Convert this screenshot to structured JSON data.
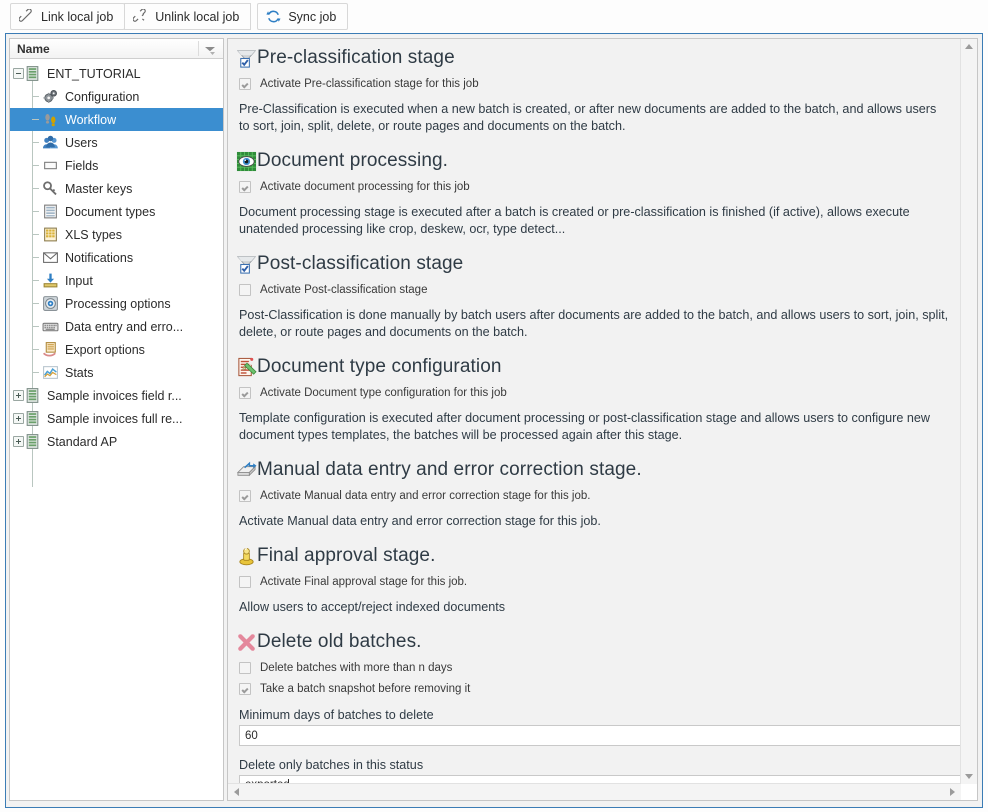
{
  "toolbar": {
    "buttons": [
      {
        "label": "Link local job",
        "icon": "link-icon"
      },
      {
        "label": "Unlink local job",
        "icon": "unlink-icon"
      },
      {
        "label": "Sync job",
        "icon": "sync-icon"
      }
    ]
  },
  "tree": {
    "header": "Name",
    "sort_icon": "sort-filter-icon",
    "nodes": [
      {
        "label": "ENT_TUTORIAL",
        "icon": "server-icon",
        "depth": 0,
        "expander": "minus",
        "selected": false
      },
      {
        "label": "Configuration",
        "icon": "gears-icon",
        "depth": 1,
        "expander": "none",
        "selected": false
      },
      {
        "label": "Workflow",
        "icon": "footprints-icon",
        "depth": 1,
        "expander": "none",
        "selected": true
      },
      {
        "label": "Users",
        "icon": "users-icon",
        "depth": 1,
        "expander": "none",
        "selected": false
      },
      {
        "label": "Fields",
        "icon": "field-box-icon",
        "depth": 1,
        "expander": "none",
        "selected": false
      },
      {
        "label": "Master keys",
        "icon": "key-icon",
        "depth": 1,
        "expander": "none",
        "selected": false
      },
      {
        "label": "Document types",
        "icon": "document-types-icon",
        "depth": 1,
        "expander": "none",
        "selected": false
      },
      {
        "label": "XLS types",
        "icon": "xls-icon",
        "depth": 1,
        "expander": "none",
        "selected": false
      },
      {
        "label": "Notifications",
        "icon": "envelope-icon",
        "depth": 1,
        "expander": "none",
        "selected": false
      },
      {
        "label": "Input",
        "icon": "import-icon",
        "depth": 1,
        "expander": "none",
        "selected": false
      },
      {
        "label": "Processing options",
        "icon": "processing-icon",
        "depth": 1,
        "expander": "none",
        "selected": false
      },
      {
        "label": "Data entry and erro...",
        "icon": "keyboard-icon",
        "depth": 1,
        "expander": "none",
        "selected": false
      },
      {
        "label": "Export options",
        "icon": "export-icon",
        "depth": 1,
        "expander": "none",
        "selected": false
      },
      {
        "label": "Stats",
        "icon": "chart-line-icon",
        "depth": 1,
        "expander": "none",
        "selected": false
      },
      {
        "label": "Sample invoices field r...",
        "icon": "server-icon",
        "depth": 0,
        "expander": "plus",
        "selected": false
      },
      {
        "label": "Sample invoices full re...",
        "icon": "server-icon",
        "depth": 0,
        "expander": "plus",
        "selected": false
      },
      {
        "label": "Standard AP",
        "icon": "server-icon",
        "depth": 0,
        "expander": "plus",
        "selected": false
      }
    ]
  },
  "main": {
    "sections": [
      {
        "title": "Pre-classification stage",
        "icon": "funnel-check-icon",
        "checkbox": {
          "label": "Activate Pre-classification stage for this job",
          "checked": true
        },
        "paragraph": "Pre-Classification is executed when a new batch is created, or after new documents are added to the batch, and allows users to sort, join, split, delete, or route pages and documents on the batch."
      },
      {
        "title": "Document processing.",
        "icon": "eye-green-icon",
        "checkbox": {
          "label": "Activate document processing for this job",
          "checked": true
        },
        "paragraph": "Document processing stage is executed after a batch is created or pre-classification is finished (if active), allows execute unatended processing like crop, deskew, ocr, type detect..."
      },
      {
        "title": "Post-classification stage",
        "icon": "funnel-check-icon",
        "checkbox": {
          "label": "Activate Post-classification stage",
          "checked": false
        },
        "paragraph": "Post-Classification is done manually by batch users after documents are added to the batch, and allows users to sort, join, split, delete, or route pages and documents on the batch."
      },
      {
        "title": "Document type configuration",
        "icon": "document-edit-icon",
        "checkbox": {
          "label": "Activate Document type configuration for this job",
          "checked": true
        },
        "paragraph": "Template configuration is executed after document processing or post-classification stage and allows users to configure new document types templates, the batches will be processed again after this stage."
      },
      {
        "title": "Manual data entry and error correction stage.",
        "icon": "data-entry-icon",
        "checkbox": {
          "label": "Activate Manual data entry and error correction stage for this job.",
          "checked": true
        },
        "paragraph": "Activate Manual data entry and error correction stage for this job."
      },
      {
        "title": "Final approval stage.",
        "icon": "stamp-icon",
        "checkbox": {
          "label": "Activate Final approval stage for this job.",
          "checked": false
        },
        "paragraph": "Allow users to accept/reject indexed documents"
      }
    ],
    "delete_section": {
      "title": "Delete old batches.",
      "icon": "red-x-icon",
      "checkboxes": [
        {
          "label": "Delete batches with more than n days",
          "checked": false
        },
        {
          "label": "Take a batch snapshot before removing it",
          "checked": true
        }
      ],
      "min_days_label": "Minimum days of batches to delete",
      "min_days_value": "60",
      "status_label": "Delete only batches in this status",
      "status_value": "exported"
    }
  },
  "colors": {
    "selection": "#3b8ed0",
    "window_border": "#3b7cb5",
    "heading_text": "#2f3b45"
  }
}
